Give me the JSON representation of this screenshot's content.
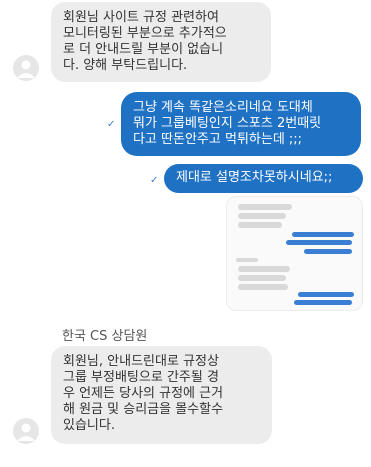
{
  "conversation": {
    "messages": [
      {
        "direction": "incoming",
        "text": "회원님 사이트 규정 관련하여\n모니터링된 부분으로 추가적으\n로 더 안내드릴 부분이 없습니\n다. 양해 부탁드립니다."
      },
      {
        "direction": "outgoing",
        "text": "그냥 계속 똑같은소리네요 도대체\n뭐가 그룹베팅인지 스포츠 2번때릿\n다고 딴돈안주고 먹튀하는데 ;;;"
      },
      {
        "direction": "outgoing",
        "text": "제대로 설명조차못하시네요;;"
      },
      {
        "direction": "outgoing",
        "type": "image-attachment"
      },
      {
        "direction": "incoming",
        "sender": "한국 CS 상담원",
        "text": "회원님, 안내드린대로 규정상\n그룹 부정배팅으로 간주될 경\n우 언제든 당사의 규정에 근거\n해 원금 및 승리금을 몰수할수\n있습니다."
      }
    ],
    "read_mark": "✓"
  },
  "icons": {
    "avatar": "user-avatar-icon",
    "read": "checkmark-icon"
  },
  "colors": {
    "outgoing_bubble": "#1f71c4",
    "incoming_bubble": "#ececec"
  }
}
